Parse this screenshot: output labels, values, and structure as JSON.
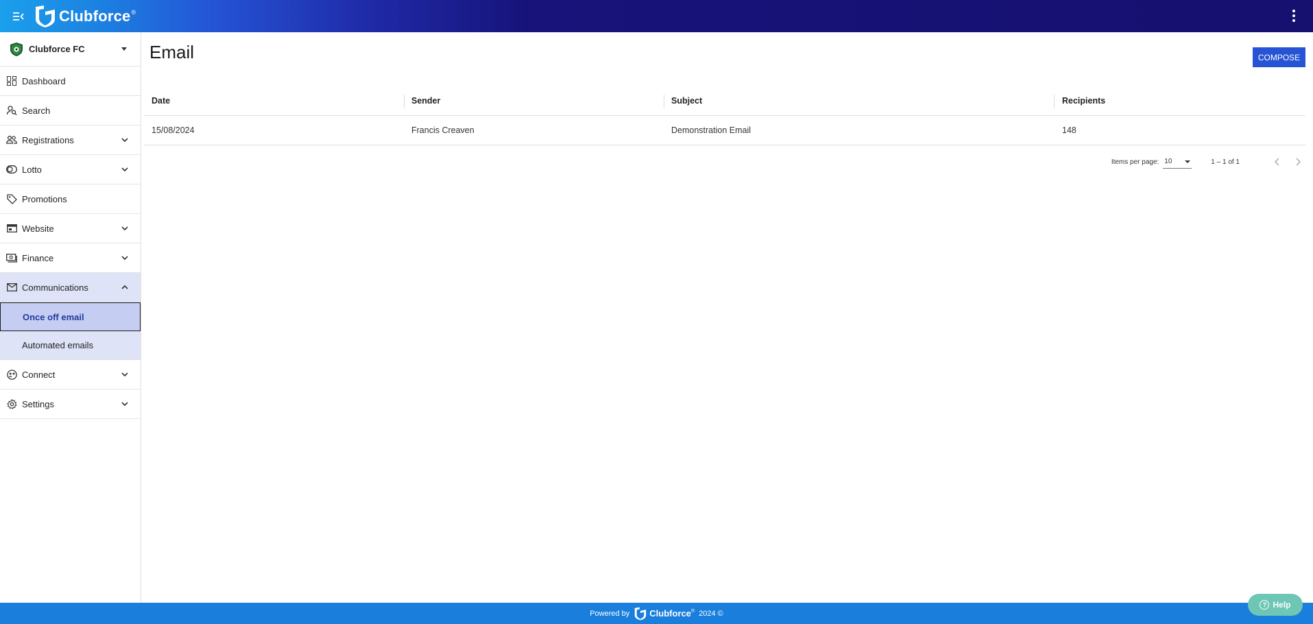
{
  "app": {
    "brand": "Clubforce",
    "brand_mark": "®"
  },
  "sidebar": {
    "club_name": "Clubforce FC",
    "items": [
      {
        "label": "Dashboard",
        "icon": "dashboard-icon"
      },
      {
        "label": "Search",
        "icon": "search-person-icon"
      },
      {
        "label": "Registrations",
        "icon": "people-icon"
      },
      {
        "label": "Lotto",
        "icon": "lotto-icon"
      },
      {
        "label": "Promotions",
        "icon": "tag-icon"
      },
      {
        "label": "Website",
        "icon": "website-icon"
      },
      {
        "label": "Finance",
        "icon": "finance-icon"
      },
      {
        "label": "Communications",
        "icon": "mail-icon"
      },
      {
        "label": "Connect",
        "icon": "connect-icon"
      },
      {
        "label": "Settings",
        "icon": "gear-icon"
      }
    ],
    "sub_items": [
      {
        "label": "Once off email",
        "active": true
      },
      {
        "label": "Automated emails",
        "active": false
      }
    ]
  },
  "main": {
    "title": "Email",
    "compose_label": "COMPOSE"
  },
  "table": {
    "columns": [
      "Date",
      "Sender",
      "Subject",
      "Recipients"
    ],
    "rows": [
      {
        "date": "15/08/2024",
        "sender": "Francis Creaven",
        "subject": "Demonstration Email",
        "recipients": "148"
      }
    ]
  },
  "paginator": {
    "items_per_page_label": "Items per page:",
    "items_per_page": "10",
    "range": "1 – 1 of 1"
  },
  "footer": {
    "powered_by": "Powered by",
    "brand": "Clubforce",
    "brand_mark": "®",
    "year": "2024 ©"
  },
  "help": {
    "label": "Help"
  },
  "colors": {
    "accent": "#2654d4",
    "footer": "#1a7fdc",
    "help": "#6ec6b5",
    "active_nav_bg": "#c5cdf2"
  }
}
